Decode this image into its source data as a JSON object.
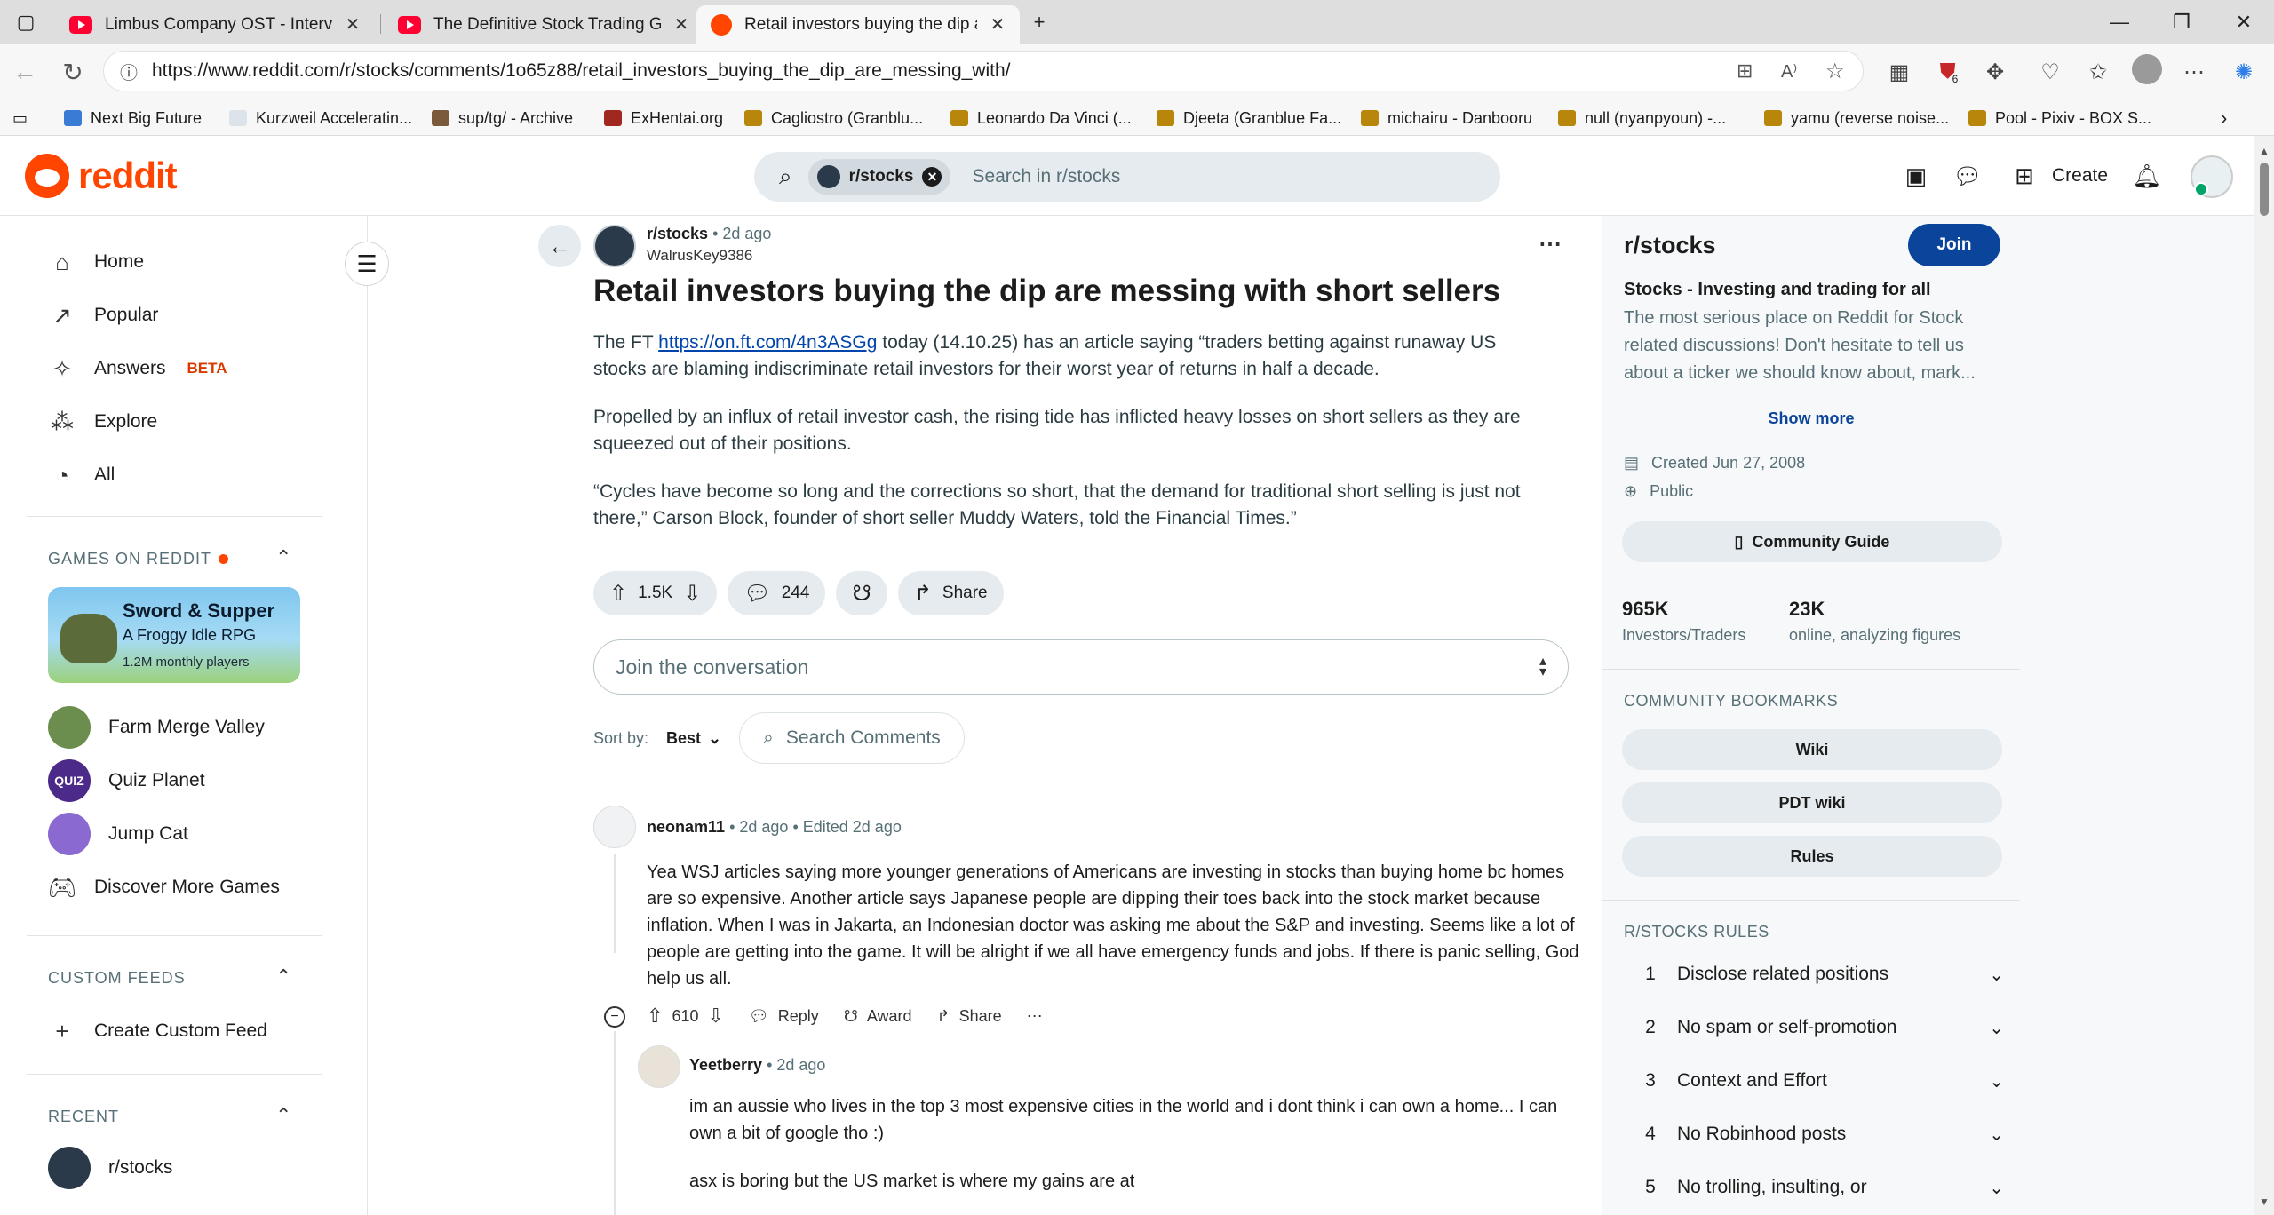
{
  "browser": {
    "tabs": [
      {
        "title": "Limbus Company OST - Intervallo",
        "icon": "youtube-icon"
      },
      {
        "title": "The Definitive Stock Trading Guide",
        "icon": "youtube-icon"
      },
      {
        "title": "Retail investors buying the dip are messing with",
        "icon": "reddit-icon"
      }
    ],
    "url": "https://www.reddit.com/r/stocks/comments/1o65z88/retail_investors_buying_the_dip_are_messing_with/",
    "extension_badge": "6",
    "bookmarks": [
      "Next Big Future",
      "Kurzweil Acceleratin...",
      "sup/tg/ - Archive",
      "ExHentai.org",
      "Cagliostro (Granblu...",
      "Leonardo Da Vinci (...",
      "Djeeta (Granblue Fa...",
      "michairu - Danbooru",
      "null (nyanpyoun) -...",
      "yamu (reverse noise...",
      "Pool - Pixiv - BOX S..."
    ]
  },
  "header": {
    "logo_text": "reddit",
    "search_chip": "r/stocks",
    "search_placeholder": "Search in r/stocks",
    "create_label": "Create"
  },
  "sidebar": {
    "nav": [
      {
        "label": "Home",
        "icon": "home-icon"
      },
      {
        "label": "Popular",
        "icon": "popular-icon"
      },
      {
        "label": "Answers",
        "badge": "BETA",
        "icon": "answers-icon"
      },
      {
        "label": "Explore",
        "icon": "explore-icon"
      },
      {
        "label": "All",
        "icon": "all-icon"
      }
    ],
    "games_heading": "GAMES ON REDDIT",
    "featured_game": {
      "title": "Sword & Supper",
      "subtitle": "A Froggy Idle RPG",
      "players": "1.2M monthly players"
    },
    "games": [
      "Farm Merge Valley",
      "Quiz Planet",
      "Jump Cat",
      "Discover More Games"
    ],
    "custom_feeds_heading": "CUSTOM FEEDS",
    "create_custom_feed": "Create Custom Feed",
    "recent_heading": "RECENT",
    "recent": [
      "r/stocks"
    ]
  },
  "post": {
    "subreddit": "r/stocks",
    "time": "2d ago",
    "author": "WalrusKey9386",
    "title": "Retail investors buying the dip are messing with short sellers",
    "p1_before": "The FT ",
    "p1_link": "https://on.ft.com/4n3ASGg",
    "p1_after": " today (14.10.25) has an article saying “traders betting against runaway US stocks are blaming indiscriminate retail investors for their worst year of returns in half a decade.",
    "p2": "Propelled by an influx of retail investor cash, the rising tide has inflicted heavy losses on short sellers as they are squeezed out of their positions.",
    "p3": "“Cycles have become so long and the corrections so short, that the demand for traditional short selling is just not there,” Carson Block, founder of short seller Muddy Waters, told the Financial Times.”",
    "votes": "1.5K",
    "comments": "244",
    "share_label": "Share",
    "join_placeholder": "Join the conversation",
    "sort_label": "Sort by:",
    "sort_value": "Best",
    "search_comments_placeholder": "Search Comments"
  },
  "comments": [
    {
      "user": "neonam11",
      "time": "2d ago",
      "edited": "Edited 2d ago",
      "text": "Yea WSJ articles saying more younger generations of Americans are investing in stocks than buying home bc homes are so expensive. Another article says Japanese people are dipping their toes back into the stock market because inflation. When I was in Jakarta, an Indonesian doctor was asking me about the S&P and investing. Seems like a lot of people are getting into the game. It will be alright if we all have emergency funds and jobs. If there is panic selling, God help us all.",
      "votes": "610",
      "reply_label": "Reply",
      "award_label": "Award",
      "share_label": "Share"
    },
    {
      "user": "Yeetberry",
      "time": "2d ago",
      "text": "im an aussie who lives in the top 3 most expensive cities in the world and i dont think i can own a home... I can own a bit of google tho :)",
      "text2": "asx is boring but the US market is where my gains are at"
    }
  ],
  "community": {
    "name": "r/stocks",
    "join_label": "Join",
    "tagline": "Stocks - Investing and trading for all",
    "description": "The most serious place on Reddit for Stock related discussions! Don't hesitate to tell us about a ticker we should know about, mark...",
    "show_more": "Show more",
    "created": "Created Jun 27, 2008",
    "visibility": "Public",
    "guide_label": "Community Guide",
    "members": "965K",
    "members_label": "Investors/Traders",
    "online": "23K",
    "online_label": "online, analyzing figures",
    "bookmarks_heading": "COMMUNITY BOOKMARKS",
    "bookmarks": [
      "Wiki",
      "PDT wiki",
      "Rules"
    ],
    "rules_heading": "R/STOCKS RULES",
    "rules": [
      {
        "n": "1",
        "text": "Disclose related positions"
      },
      {
        "n": "2",
        "text": "No spam or self-promotion"
      },
      {
        "n": "3",
        "text": "Context and Effort"
      },
      {
        "n": "4",
        "text": "No Robinhood posts"
      },
      {
        "n": "5",
        "text": "No trolling, insulting, or"
      }
    ]
  },
  "colors": {
    "brand": "#ff4500",
    "join_button": "#0a449b",
    "link": "#0045ac"
  }
}
